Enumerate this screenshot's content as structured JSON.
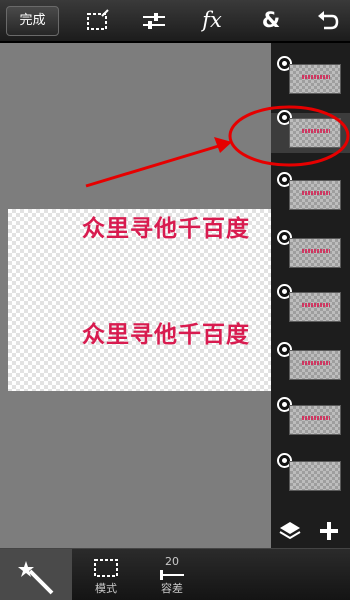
{
  "toolbar": {
    "done_label": "完成",
    "icons": [
      "selection-icon",
      "adjust-sliders-icon",
      "fx-icon",
      "blend-icon",
      "undo-icon"
    ],
    "fx_label": "fx",
    "blend_label": "&"
  },
  "canvas": {
    "text_line_1": "众里寻他千百度",
    "text_line_2": "众里寻他千百度",
    "text_color": "#d81b4f"
  },
  "layers": {
    "count": 8,
    "selected_index": 1
  },
  "annotation": {
    "color": "#e60000"
  },
  "bottom": {
    "mode_label": "模式",
    "tolerance_label": "容差",
    "tolerance_value": "20"
  }
}
